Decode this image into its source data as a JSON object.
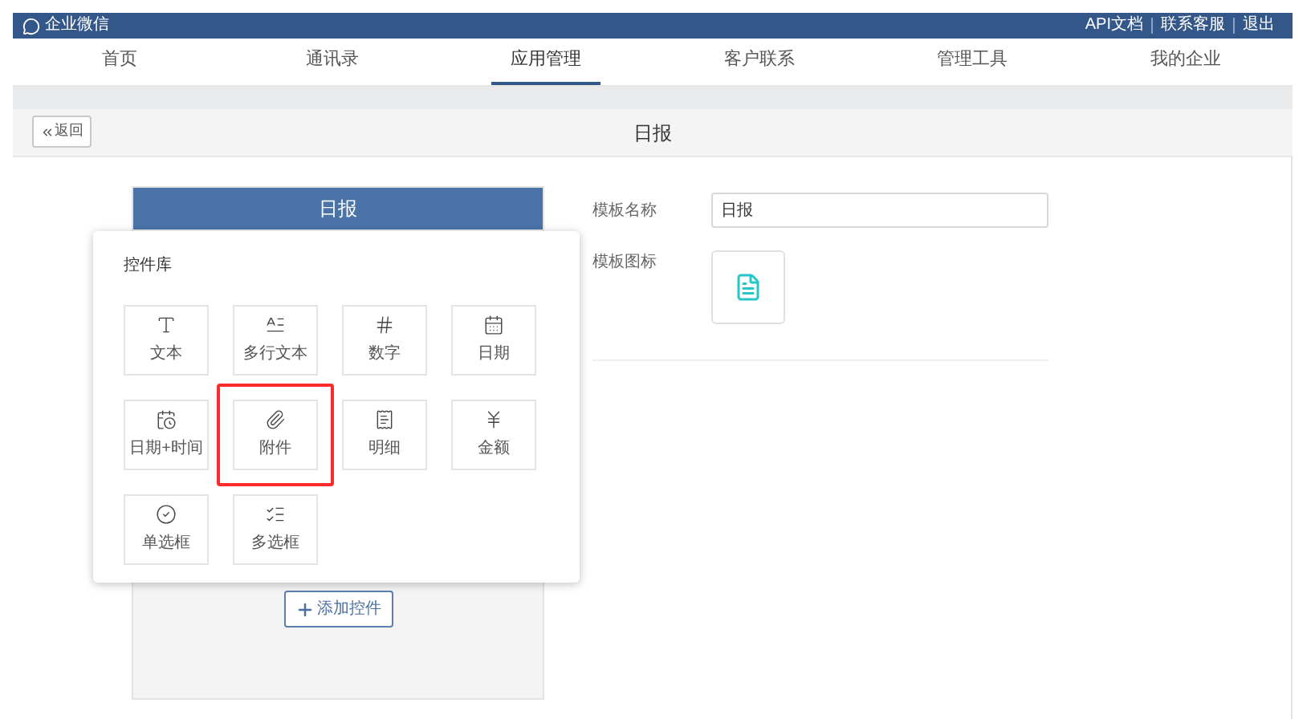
{
  "top_bar": {
    "brand": "企业微信",
    "links": [
      "API文档",
      "联系客服",
      "退出"
    ]
  },
  "nav": [
    {
      "label": "首页",
      "selected": false
    },
    {
      "label": "通讯录",
      "selected": false
    },
    {
      "label": "应用管理",
      "selected": true
    },
    {
      "label": "客户联系",
      "selected": false
    },
    {
      "label": "管理工具",
      "selected": false
    },
    {
      "label": "我的企业",
      "selected": false
    }
  ],
  "header": {
    "back": "返回",
    "title": "日报"
  },
  "preview": {
    "title": "日报",
    "add_button": "添加控件"
  },
  "library": {
    "title": "控件库",
    "items": [
      {
        "label": "文本",
        "kind": "text",
        "highlighted": false
      },
      {
        "label": "多行文本",
        "kind": "multiline",
        "highlighted": false
      },
      {
        "label": "数字",
        "kind": "number",
        "highlighted": false
      },
      {
        "label": "日期",
        "kind": "date",
        "highlighted": false
      },
      {
        "label": "日期+时间",
        "kind": "datetime",
        "highlighted": false
      },
      {
        "label": "附件",
        "kind": "attachment",
        "highlighted": true
      },
      {
        "label": "明细",
        "kind": "detail",
        "highlighted": false
      },
      {
        "label": "金额",
        "kind": "amount",
        "highlighted": false
      },
      {
        "label": "单选框",
        "kind": "single",
        "highlighted": false
      },
      {
        "label": "多选框",
        "kind": "multi",
        "highlighted": false
      }
    ]
  },
  "form": {
    "name_label": "模板名称",
    "name_value": "日报",
    "icon_label": "模板图标"
  }
}
